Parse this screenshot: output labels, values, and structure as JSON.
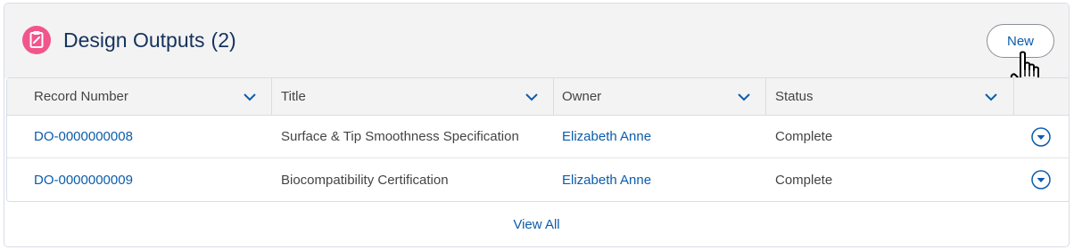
{
  "header": {
    "title": "Design Outputs",
    "count": "(2)",
    "icon": "clipboard-icon",
    "icon_color": "#f1558b",
    "new_button_label": "New"
  },
  "table": {
    "columns": [
      "Record Number",
      "Title",
      "Owner",
      "Status"
    ],
    "rows": [
      {
        "record_number": "DO-0000000008",
        "title": "Surface & Tip Smoothness Specification",
        "owner": "Elizabeth Anne",
        "status": "Complete"
      },
      {
        "record_number": "DO-0000000009",
        "title": "Biocompatibility Certification",
        "owner": "Elizabeth Anne",
        "status": "Complete"
      }
    ]
  },
  "footer": {
    "view_all_label": "View All"
  },
  "colors": {
    "link": "#0b5cab",
    "header_bg": "#f3f3f3",
    "title_text": "#16325c"
  }
}
